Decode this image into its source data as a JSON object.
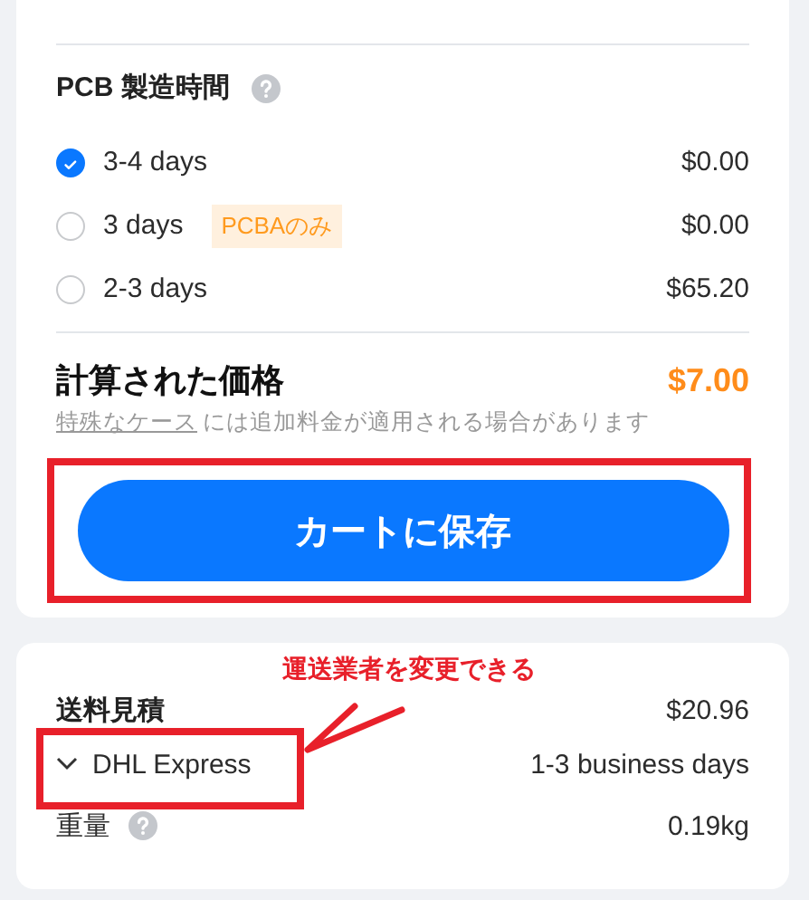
{
  "build_time": {
    "title": "PCB 製造時間",
    "options": [
      {
        "label": "3-4 days",
        "price": "$0.00",
        "selected": true
      },
      {
        "label": "3 days",
        "tag": "PCBAのみ",
        "price": "$0.00",
        "selected": false
      },
      {
        "label": "2-3 days",
        "price": "$65.20",
        "selected": false
      }
    ]
  },
  "calculated": {
    "label": "計算された価格",
    "price": "$7.00",
    "note_link": "特殊なケース",
    "note": "には追加料金が適用される場合があります"
  },
  "save_button": "カートに保存",
  "shipping": {
    "title": "送料見積",
    "price": "$20.96",
    "carrier": "DHL Express",
    "expanded": false,
    "delivery": "1-3 business days",
    "weight_label": "重量",
    "weight": "0.19kg"
  },
  "annotation": {
    "text": "運送業者を変更できる"
  }
}
